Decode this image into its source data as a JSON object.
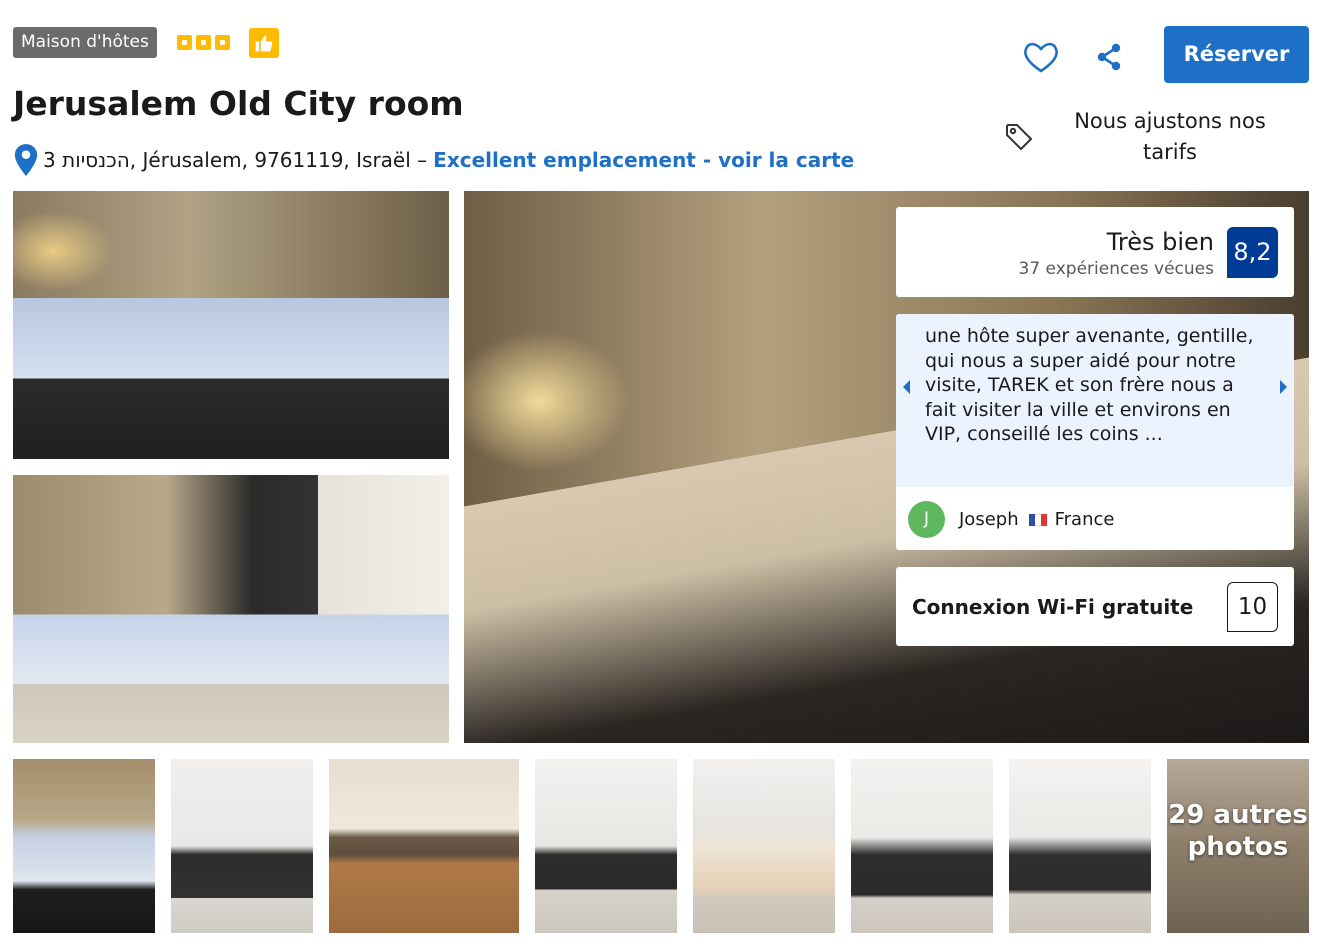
{
  "header": {
    "property_type": "Maison d'hôtes",
    "star_rating": 3,
    "title": "Jerusalem Old City room",
    "address": "3 הכנסיות, Jérusalem, 9761119, Israël –",
    "map_link": "Excellent emplacement - voir la carte",
    "icons": {
      "pin": "map-pin-icon",
      "thumbs_up": "thumbs-up-icon",
      "heart": "heart-icon",
      "share": "share-icon",
      "tag": "price-tag-icon"
    }
  },
  "actions": {
    "reserve_label": "Réserver",
    "price_note": "Nous ajustons nos tarifs"
  },
  "rating": {
    "label": "Très bien",
    "count": "37 expériences vécues",
    "score": "8,2"
  },
  "review": {
    "text": "une hôte super avenante, gentille, qui nous a super aidé pour notre visite, TAREK et son frère nous a fait visiter la ville et environs en VIP, conseillé les coins ...",
    "avatar_initial": "J",
    "reviewer_name": "Joseph",
    "reviewer_country": "France"
  },
  "wifi": {
    "label": "Connexion Wi-Fi gratuite",
    "score": "10"
  },
  "gallery": {
    "more_photos": "29 autres photos"
  },
  "colors": {
    "brand_blue": "#1e6fc6",
    "score_blue": "#003b95",
    "star_yellow": "#febb02",
    "avatar_green": "#5fb760"
  }
}
